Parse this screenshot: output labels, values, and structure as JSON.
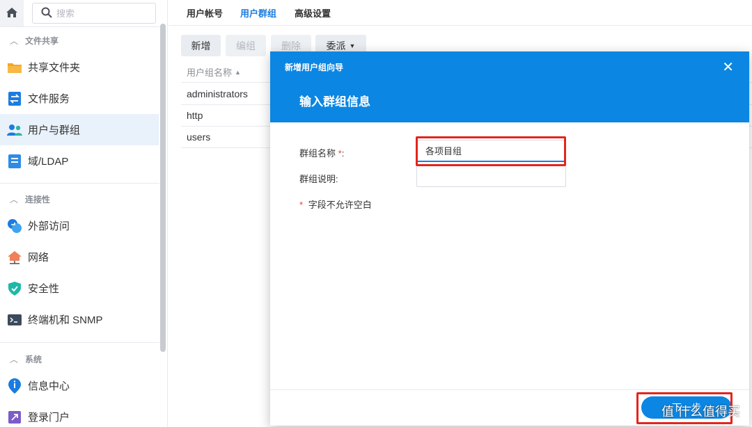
{
  "sidebar": {
    "search_placeholder": "搜索",
    "sections": [
      {
        "label": "文件共享",
        "items": [
          "共享文件夹",
          "文件服务",
          "用户与群组",
          "域/LDAP"
        ]
      },
      {
        "label": "连接性",
        "items": [
          "外部访问",
          "网络",
          "安全性",
          "终端机和 SNMP"
        ]
      },
      {
        "label": "系统",
        "items": [
          "信息中心",
          "登录门户"
        ]
      }
    ],
    "active_item": "用户与群组"
  },
  "tabs": [
    "用户帐号",
    "用户群组",
    "高级设置"
  ],
  "active_tab": "用户群组",
  "toolbar": {
    "add": "新增",
    "edit": "编组",
    "delete": "删除",
    "delegate": "委派"
  },
  "grid": {
    "column": "用户组名称",
    "rows": [
      "administrators",
      "http",
      "users"
    ]
  },
  "dialog": {
    "title": "新增用户组向导",
    "subtitle": "输入群组信息",
    "name_label": "群组名称",
    "name_value": "各项目组",
    "desc_label": "群组说明:",
    "desc_value": "",
    "required_note": "字段不允许空白",
    "next_button": "下一步"
  },
  "watermark": "值 什么值得买",
  "colors": {
    "accent": "#0b86e3",
    "highlight": "#e3251d",
    "active_bg": "#e9f1fb"
  }
}
